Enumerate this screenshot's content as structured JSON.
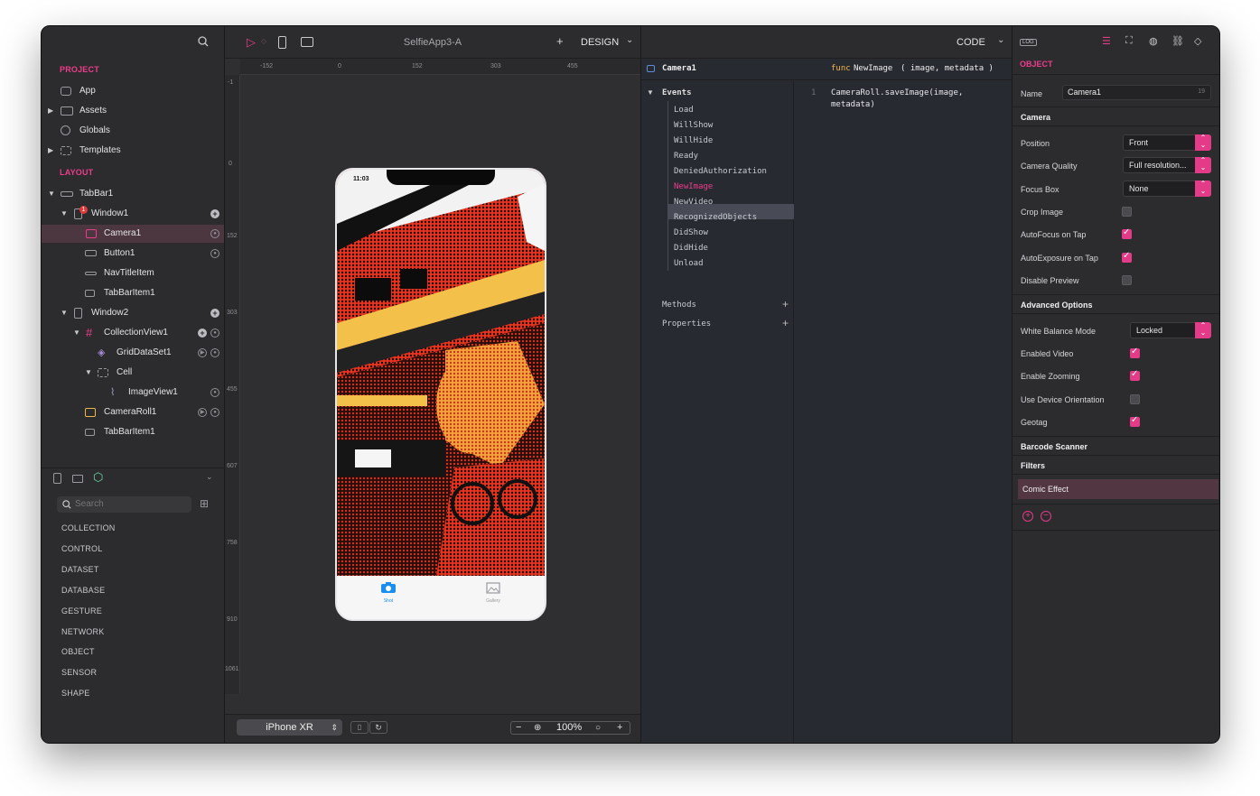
{
  "window": {
    "title": "SelfieApp3-A"
  },
  "toolbar": {
    "add_label": "+",
    "design_label": "DESIGN",
    "code_label": "CODE",
    "log_label": "LOG"
  },
  "project": {
    "section_label": "PROJECT",
    "items": [
      {
        "label": "App",
        "icon": "app-icon"
      },
      {
        "label": "Assets",
        "icon": "assets-icon"
      },
      {
        "label": "Globals",
        "icon": "globe-icon"
      },
      {
        "label": "Templates",
        "icon": "templates-icon"
      }
    ]
  },
  "layout": {
    "section_label": "LAYOUT",
    "items": [
      {
        "label": "TabBar1"
      },
      {
        "label": "Window1",
        "badge": "1"
      },
      {
        "label": "Camera1"
      },
      {
        "label": "Button1"
      },
      {
        "label": "NavTitleItem"
      },
      {
        "label": "TabBarItem1"
      },
      {
        "label": "Window2"
      },
      {
        "label": "CollectionView1"
      },
      {
        "label": "GridDataSet1"
      },
      {
        "label": "Cell"
      },
      {
        "label": "ImageView1"
      },
      {
        "label": "CameraRoll1"
      },
      {
        "label": "TabBarItem1"
      }
    ]
  },
  "library": {
    "search_placeholder": "Search",
    "categories": [
      "COLLECTION",
      "CONTROL",
      "DATASET",
      "DATABASE",
      "GESTURE",
      "NETWORK",
      "OBJECT",
      "SENSOR",
      "SHAPE"
    ]
  },
  "rulers": {
    "horizontal": [
      "-152",
      "0",
      "152",
      "303",
      "455"
    ],
    "vertical": [
      "-1",
      "0",
      "152",
      "303",
      "455",
      "607",
      "758",
      "910",
      "1061"
    ]
  },
  "phone": {
    "status_time": "11:03",
    "tabs": [
      {
        "label": "Shot",
        "icon": "camera-icon",
        "active": true
      },
      {
        "label": "Gallery",
        "icon": "gallery-icon",
        "active": false
      }
    ]
  },
  "canvas_bottom": {
    "device": "iPhone XR",
    "zoom": "100%",
    "zoom_out": "−",
    "zoom_in": "+"
  },
  "code": {
    "object_name": "Camera1",
    "func_keyword": "func",
    "func_name": "NewImage",
    "func_params": "( image, metadata )",
    "events_label": "Events",
    "events": [
      "Load",
      "WillShow",
      "WillHide",
      "Ready",
      "DeniedAuthorization",
      "NewImage",
      "NewVideo",
      "RecognizedObjects",
      "DidShow",
      "DidHide",
      "Unload"
    ],
    "selected_event": "NewImage",
    "methods_label": "Methods",
    "properties_label": "Properties",
    "line_number": "1",
    "line_1": "CameraRoll.saveImage(image,",
    "line_2": "metadata)"
  },
  "inspector": {
    "section_label": "OBJECT",
    "name_label": "Name",
    "name_value": "Camera1",
    "name_count": "19",
    "camera_label": "Camera",
    "position_label": "Position",
    "position_value": "Front",
    "quality_label": "Camera Quality",
    "quality_value": "Full resolution...",
    "focus_label": "Focus Box",
    "focus_value": "None",
    "crop_label": "Crop Image",
    "crop_checked": false,
    "autofocus_label": "AutoFocus on Tap",
    "autofocus_checked": true,
    "autoexposure_label": "AutoExposure on Tap",
    "autoexposure_checked": true,
    "disable_preview_label": "Disable Preview",
    "disable_preview_checked": false,
    "advanced_label": "Advanced Options",
    "wb_label": "White Balance Mode",
    "wb_value": "Locked",
    "video_label": "Enabled Video",
    "video_checked": true,
    "zoom_label": "Enable Zooming",
    "zoom_checked": true,
    "orientation_label": "Use Device Orientation",
    "orientation_checked": false,
    "geotag_label": "Geotag",
    "geotag_checked": true,
    "barcode_label": "Barcode Scanner",
    "filters_label": "Filters",
    "filter_item": "Comic Effect"
  },
  "colors": {
    "accent": "#e33b87",
    "panel": "#2c2c2e",
    "code_bg": "#282a31"
  }
}
